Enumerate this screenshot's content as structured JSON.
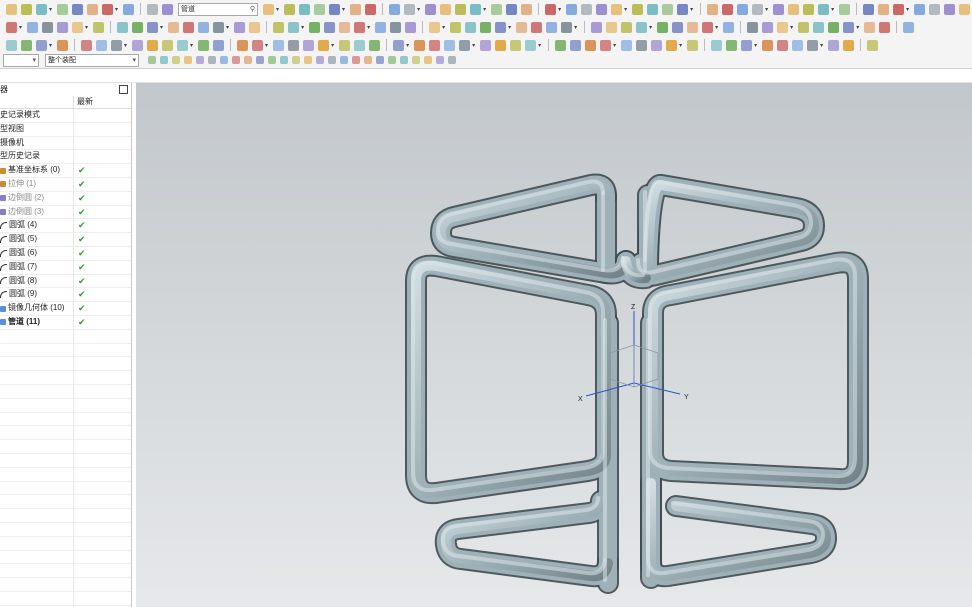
{
  "toolbar": {
    "search_combo": "管道",
    "type_filter": "",
    "scope_filter": "整个装配"
  },
  "navigator": {
    "title": "器",
    "columns": [
      "",
      "最新"
    ],
    "rows": [
      {
        "label": "史记录模式",
        "check": "",
        "style": "",
        "icon": "none"
      },
      {
        "label": "型视图",
        "check": "",
        "style": "",
        "icon": "none"
      },
      {
        "label": "摄像机",
        "check": "",
        "style": "",
        "icon": "none"
      },
      {
        "label": "型历史记录",
        "check": "",
        "style": "",
        "icon": "none"
      },
      {
        "label": "基准坐标系 (0)",
        "check": "✔",
        "style": "",
        "icon": "csys-icon"
      },
      {
        "label": "拉伸 (1)",
        "check": "✔",
        "style": "gray",
        "icon": "extrude-icon"
      },
      {
        "label": "边倒圆 (2)",
        "check": "✔",
        "style": "gray",
        "icon": "blend-icon"
      },
      {
        "label": "边倒圆 (3)",
        "check": "✔",
        "style": "gray",
        "icon": "blend-icon"
      },
      {
        "label": "圆弧 (4)",
        "check": "✔",
        "style": "",
        "icon": "arc-icon"
      },
      {
        "label": "圆弧 (5)",
        "check": "✔",
        "style": "",
        "icon": "arc-icon"
      },
      {
        "label": "圆弧 (6)",
        "check": "✔",
        "style": "",
        "icon": "arc-icon"
      },
      {
        "label": "圆弧 (7)",
        "check": "✔",
        "style": "",
        "icon": "arc-icon"
      },
      {
        "label": "圆弧 (8)",
        "check": "✔",
        "style": "",
        "icon": "arc-icon"
      },
      {
        "label": "圆弧 (9)",
        "check": "✔",
        "style": "",
        "icon": "arc-icon"
      },
      {
        "label": "镜像几何体 (10)",
        "check": "✔",
        "style": "",
        "icon": "mirror-icon"
      },
      {
        "label": "管道 (11)",
        "check": "✔",
        "style": "bold",
        "icon": "tube-icon"
      }
    ],
    "empty_rows": 22
  },
  "viewport": {
    "axes": {
      "x": "X",
      "y": "Y",
      "z": "Z"
    },
    "colors": {
      "tube_dark": "#3f4a4f",
      "tube_mid": "#9fb1b8",
      "tube_light": "#dbe6ea",
      "axis_x": "#2f54c8",
      "axis_y": "#2f54c8",
      "axis_z": "#2f54c8",
      "background_top": "#c2c7cb",
      "background_bottom": "#e6e8ea"
    }
  }
}
